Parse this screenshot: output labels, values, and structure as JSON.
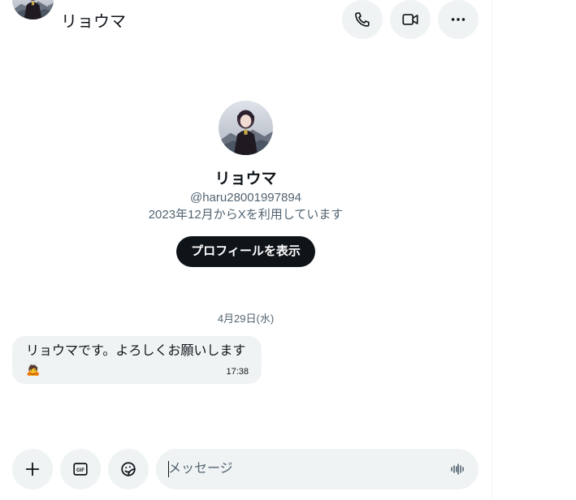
{
  "header": {
    "name": "リョウマ",
    "call_icon": "phone-icon",
    "video_icon": "video-camera-icon",
    "more_icon": "more-horizontal-icon"
  },
  "profile": {
    "name": "リョウマ",
    "handle": "@haru28001997894",
    "joined": "2023年12月からXを利用しています",
    "view_profile_label": "プロフィールを表示"
  },
  "conversation": {
    "date_separator": "4月29日(水)",
    "messages": [
      {
        "text": "リョウマです。よろしくお願いします",
        "emoji": "🙇",
        "time": "17:38"
      }
    ]
  },
  "composer": {
    "placeholder": "メッセージ",
    "add_icon": "plus-icon",
    "gif_icon": "gif-icon",
    "emoji_icon": "emoji-sticker-icon",
    "voice_icon": "voice-wave-icon"
  },
  "colors": {
    "button_bg": "#eff3f4",
    "primary_dark": "#0f1419",
    "secondary_text": "#536471"
  }
}
